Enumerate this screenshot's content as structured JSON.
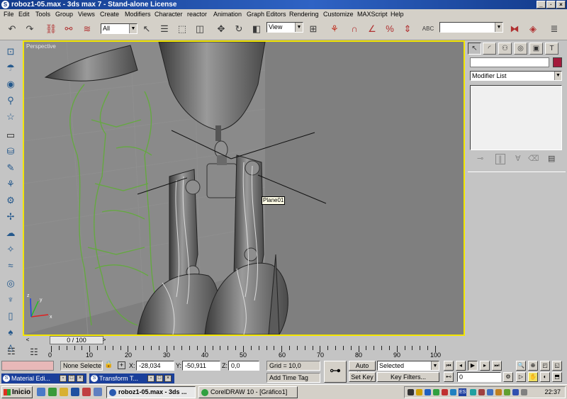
{
  "window": {
    "title": "roboz1-05.max - 3ds max 7 - Stand-alone License",
    "controls": [
      "_",
      "·",
      "×"
    ]
  },
  "menu": [
    "File",
    "Edit",
    "Tools",
    "Group",
    "Views",
    "Create",
    "Modifiers",
    "Character",
    "reactor",
    "Animation",
    "Graph Editors",
    "Rendering",
    "Customize",
    "MAXScript",
    "Help"
  ],
  "toolbar": {
    "selection_filter": "All",
    "ref_coord": "View",
    "named_selection": "",
    "abc_label": "ABC"
  },
  "viewport": {
    "label": "Perspective",
    "object_tooltip": "Plane01",
    "axis_x": "x",
    "axis_y": "y",
    "axis_z": "z"
  },
  "command_panel": {
    "object_name": "",
    "object_color": "#a31a3c",
    "modifier_list": "Modifier List"
  },
  "timeline": {
    "slider_label": "0 / 100",
    "prev": "<",
    "next": ">",
    "ticks": [
      "0",
      "10",
      "20",
      "30",
      "40",
      "50",
      "60",
      "70",
      "80",
      "90",
      "100"
    ]
  },
  "status": {
    "selection": "None Selecte",
    "x_label": "X:",
    "x_value": "-28,034",
    "y_label": "Y:",
    "y_value": "-50,911",
    "z_label": "Z:",
    "z_value": "0,0",
    "grid": "Grid = 10,0",
    "add_time_tag": "Add Time Tag",
    "auto_key": "Auto Key",
    "set_key": "Set Key",
    "key_mode": "Selected",
    "key_filters": "Key Filters...",
    "frame": "0",
    "mini_material": "Material Edi...",
    "mini_transform": "Transform T..."
  },
  "taskbar": {
    "start": "Inicio",
    "tasks": [
      "roboz1-05.max - 3ds ...",
      "CorelDRAW 10 - [Gráfico1]"
    ],
    "clock": "22:37",
    "lang": "ES"
  }
}
